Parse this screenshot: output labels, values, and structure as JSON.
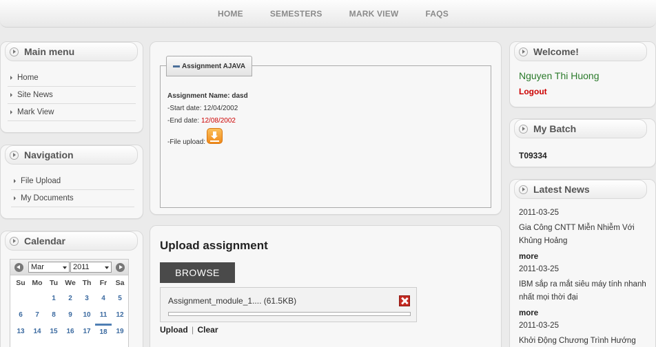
{
  "topnav": [
    "HOME",
    "SEMESTERS",
    "MARK VIEW",
    "FAQS"
  ],
  "main_menu": {
    "title": "Main menu",
    "items": [
      "Home",
      "Site News",
      "Mark View"
    ]
  },
  "navigation": {
    "title": "Navigation",
    "items": [
      "File Upload",
      "My Documents"
    ]
  },
  "calendar": {
    "title": "Calendar",
    "month": "Mar",
    "year": "2011",
    "weekdays": [
      "Su",
      "Mo",
      "Tu",
      "We",
      "Th",
      "Fr",
      "Sa"
    ],
    "weeks": [
      [
        "",
        "",
        "1",
        "2",
        "3",
        "4",
        "5"
      ],
      [
        "6",
        "7",
        "8",
        "9",
        "10",
        "11",
        "12"
      ],
      [
        "13",
        "14",
        "15",
        "16",
        "17",
        "18",
        "19"
      ]
    ],
    "today": "18"
  },
  "assignment": {
    "tab_label": "Assignment AJAVA",
    "name_label": "Assignment Name: dasd",
    "start_label": "-Start date: 12/04/2002",
    "end_prefix": "-End date:",
    "end_date": "12/08/2002",
    "file_label": "-File upload:",
    "end_date_color": "#cc0000"
  },
  "upload": {
    "title": "Upload assignment",
    "browse_label": "BROWSE",
    "file_entry": "Assignment_module_1.... (61.5KB)",
    "progress_percent": 0,
    "upload_link": "Upload",
    "separator": "|",
    "clear_link": "Clear"
  },
  "welcome": {
    "title": "Welcome!",
    "user_name": "Nguyen Thi Huong",
    "logout_label": "Logout"
  },
  "batch": {
    "title": "My Batch",
    "code": "T09334"
  },
  "news": {
    "title": "Latest News",
    "more_label": "more",
    "items": [
      {
        "date": "2011-03-25",
        "text": "Gia Công CNTT Miễn Nhiễm Với Khủng Hoảng"
      },
      {
        "date": "2011-03-25",
        "text": "IBM sắp ra mắt siêu máy tính nhanh nhất mọi thời đại"
      },
      {
        "date": "2011-03-25",
        "text": "Khởi Động Chương Trình Hướng"
      }
    ]
  }
}
